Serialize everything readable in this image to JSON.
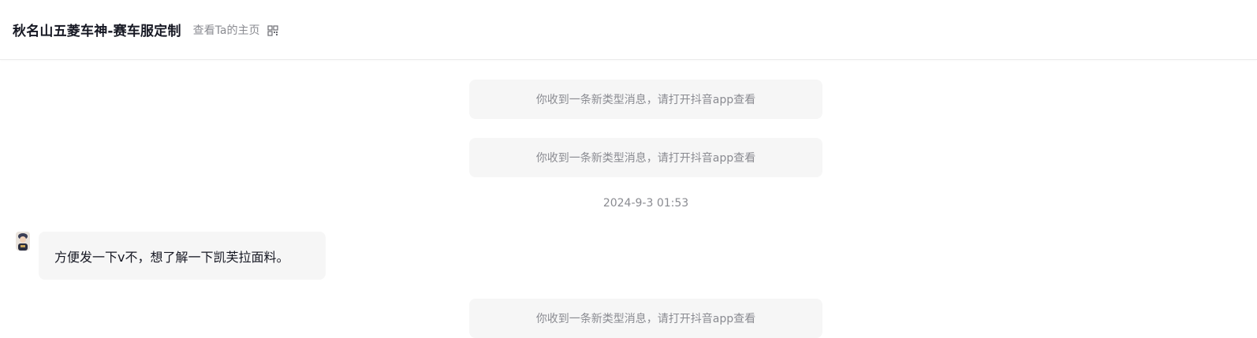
{
  "header": {
    "title": "秋名山五菱车神-赛车服定制",
    "homepage_link": "查看Ta的主页",
    "qr_icon": "qr-code-icon"
  },
  "messages": {
    "system_1": "你收到一条新类型消息，请打开抖音app查看",
    "system_2": "你收到一条新类型消息，请打开抖音app查看",
    "timestamp": "2024-9-3 01:53",
    "user_message": "方便发一下v不，想了解一下凯芙拉面料。",
    "system_3": "你收到一条新类型消息，请打开抖音app查看"
  },
  "colors": {
    "bubble_bg": "#f6f6f6",
    "muted_text": "#8a8b91",
    "primary_text": "#161823"
  }
}
